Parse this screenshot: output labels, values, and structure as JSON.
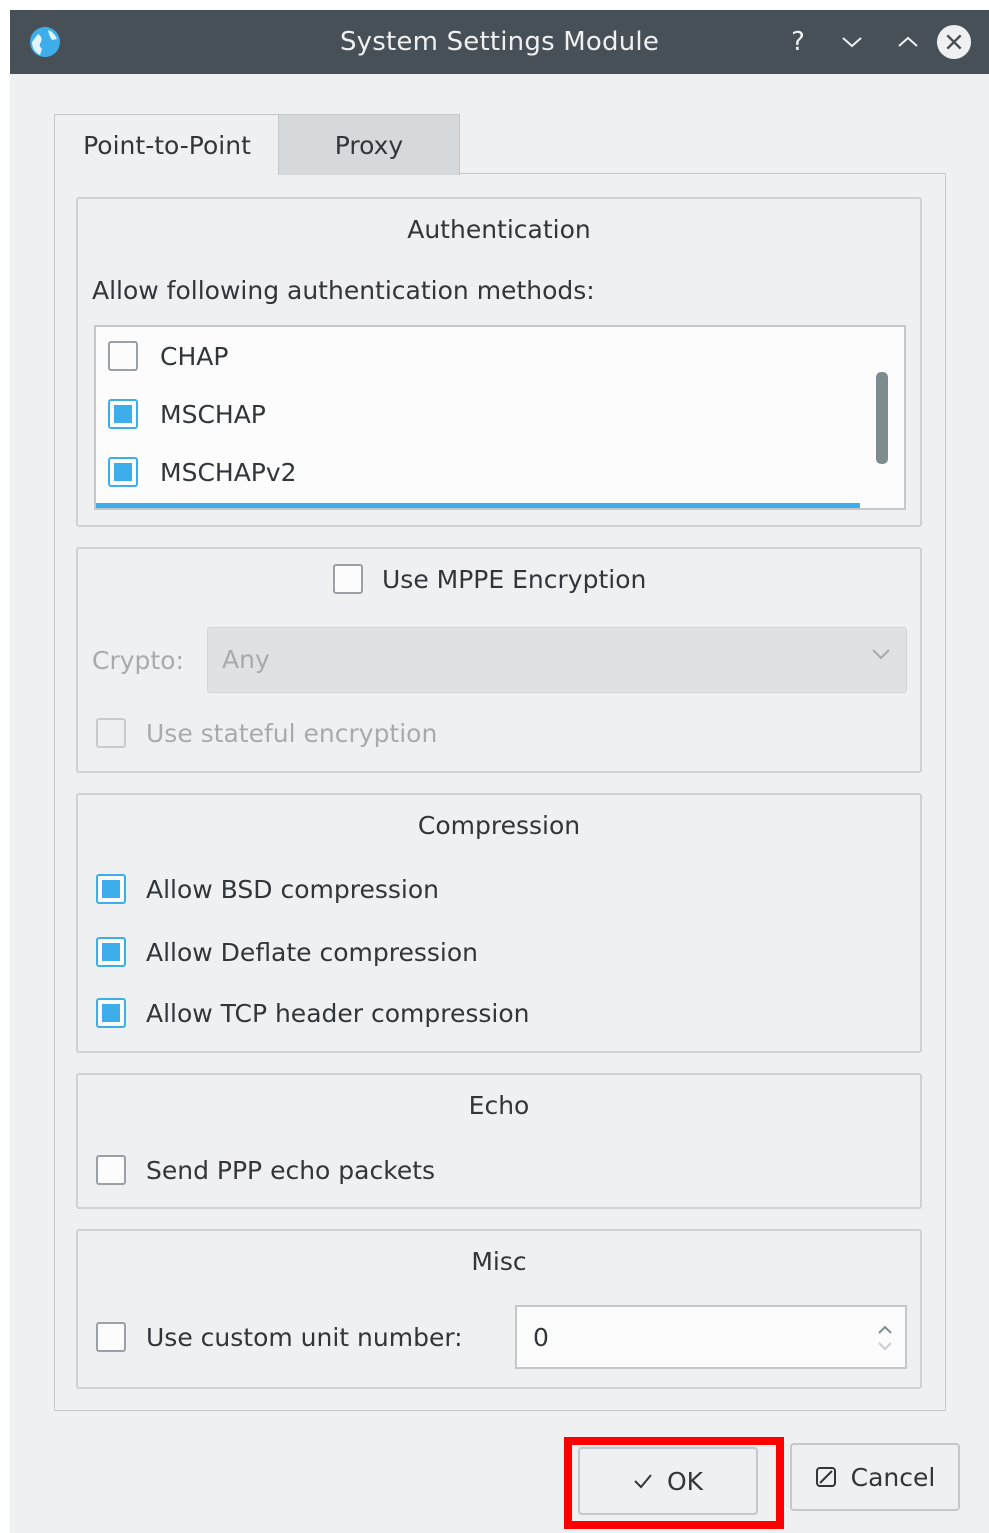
{
  "window": {
    "title": "System Settings Module",
    "buttons": [
      "help-icon",
      "minimize-icon",
      "maximize-icon",
      "close-icon"
    ]
  },
  "tabs": [
    {
      "label": "Point-to-Point",
      "active": true
    },
    {
      "label": "Proxy",
      "active": false
    }
  ],
  "authentication": {
    "title": "Authentication",
    "prompt": "Allow following authentication methods:",
    "methods": [
      {
        "label": "CHAP",
        "checked": false
      },
      {
        "label": "MSCHAP",
        "checked": true
      },
      {
        "label": "MSCHAPv2",
        "checked": true
      }
    ]
  },
  "mppe": {
    "label": "Use MPPE Encryption",
    "checked": false,
    "crypto_label": "Crypto:",
    "crypto_value": "Any",
    "stateful_label": "Use stateful encryption",
    "stateful_checked": false
  },
  "compression": {
    "title": "Compression",
    "options": [
      {
        "label": "Allow BSD compression",
        "checked": true
      },
      {
        "label": "Allow Deflate compression",
        "checked": true
      },
      {
        "label": "Allow TCP header compression",
        "checked": true
      }
    ]
  },
  "echo": {
    "title": "Echo",
    "label": "Send PPP echo packets",
    "checked": false
  },
  "misc": {
    "title": "Misc",
    "label": "Use custom unit number:",
    "checked": false,
    "unit_value": "0"
  },
  "footer": {
    "ok_label": "OK",
    "cancel_label": "Cancel"
  },
  "colors": {
    "accent": "#3daee9",
    "titlebar": "#475057",
    "highlight": "#ff0000"
  }
}
